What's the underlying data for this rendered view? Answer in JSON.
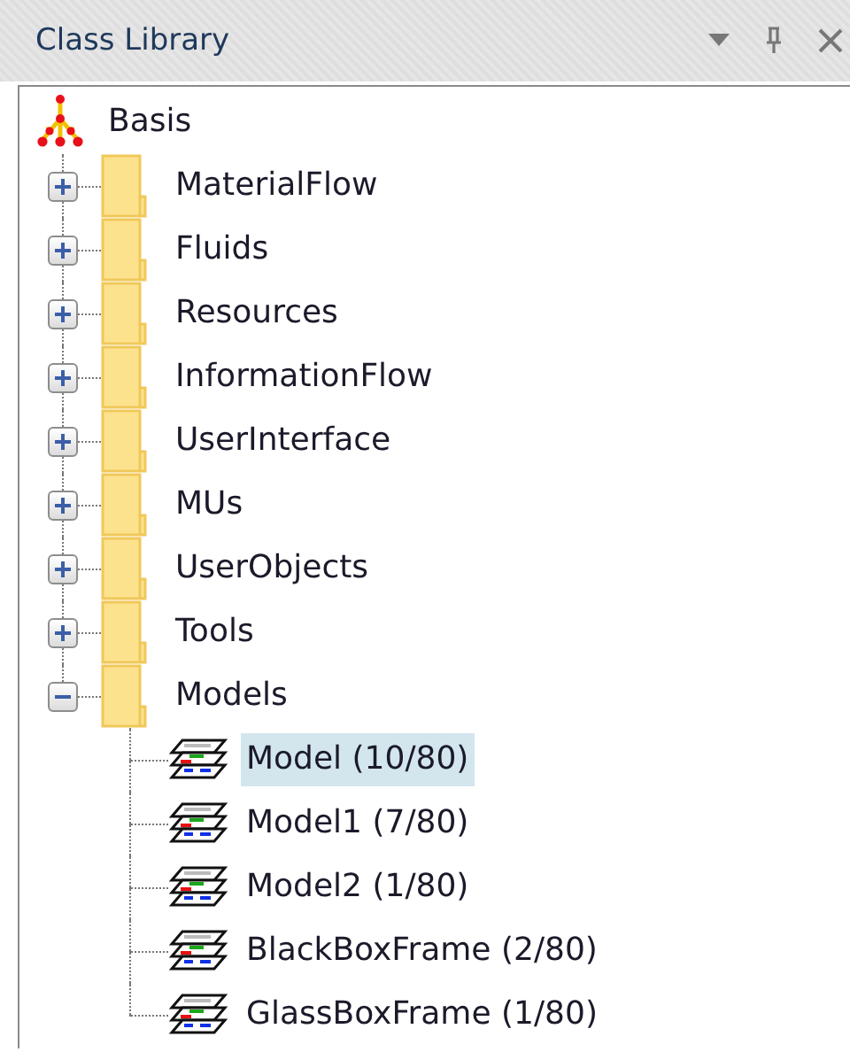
{
  "panel": {
    "title": "Class Library"
  },
  "tree": {
    "label": "Basis",
    "kind": "root",
    "selected": false,
    "children": [
      {
        "label": "MaterialFlow",
        "kind": "folder",
        "expanded": false,
        "selected": false
      },
      {
        "label": "Fluids",
        "kind": "folder",
        "expanded": false,
        "selected": false
      },
      {
        "label": "Resources",
        "kind": "folder",
        "expanded": false,
        "selected": false
      },
      {
        "label": "InformationFlow",
        "kind": "folder",
        "expanded": false,
        "selected": false
      },
      {
        "label": "UserInterface",
        "kind": "folder",
        "expanded": false,
        "selected": false
      },
      {
        "label": "MUs",
        "kind": "folder",
        "expanded": false,
        "selected": false
      },
      {
        "label": "UserObjects",
        "kind": "folder",
        "expanded": false,
        "selected": false
      },
      {
        "label": "Tools",
        "kind": "folder",
        "expanded": false,
        "selected": false
      },
      {
        "label": "Models",
        "kind": "folder",
        "expanded": true,
        "selected": false,
        "children": [
          {
            "label": "Model (10/80)",
            "kind": "model",
            "selected": true
          },
          {
            "label": "Model1 (7/80)",
            "kind": "model",
            "selected": false
          },
          {
            "label": "Model2 (1/80)",
            "kind": "model",
            "selected": false
          },
          {
            "label": "BlackBoxFrame (2/80)",
            "kind": "model",
            "selected": false
          },
          {
            "label": "GlassBoxFrame (1/80)",
            "kind": "model",
            "selected": false
          }
        ]
      }
    ]
  }
}
